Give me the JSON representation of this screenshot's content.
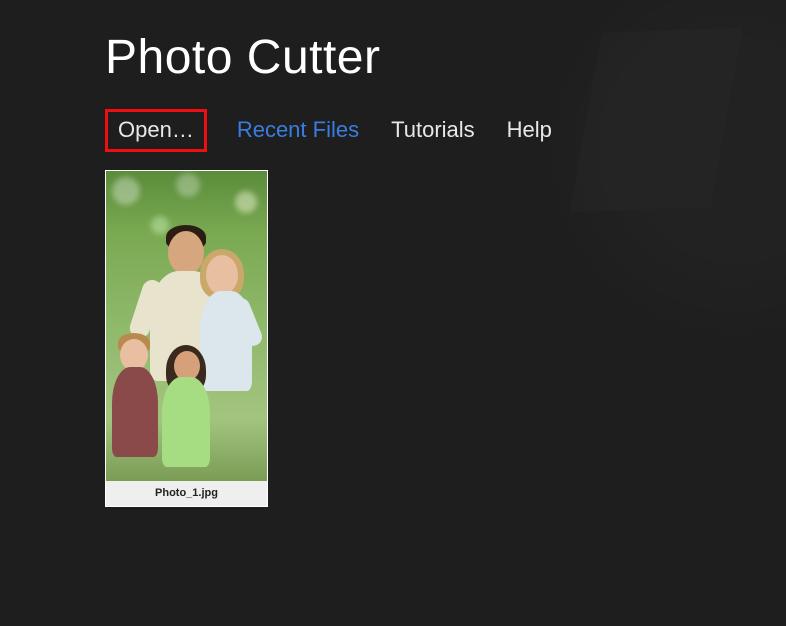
{
  "app": {
    "title": "Photo Cutter"
  },
  "nav": {
    "open": "Open…",
    "recent": "Recent Files",
    "tutorials": "Tutorials",
    "help": "Help"
  },
  "thumbnails": [
    {
      "filename": "Photo_1.jpg"
    }
  ]
}
